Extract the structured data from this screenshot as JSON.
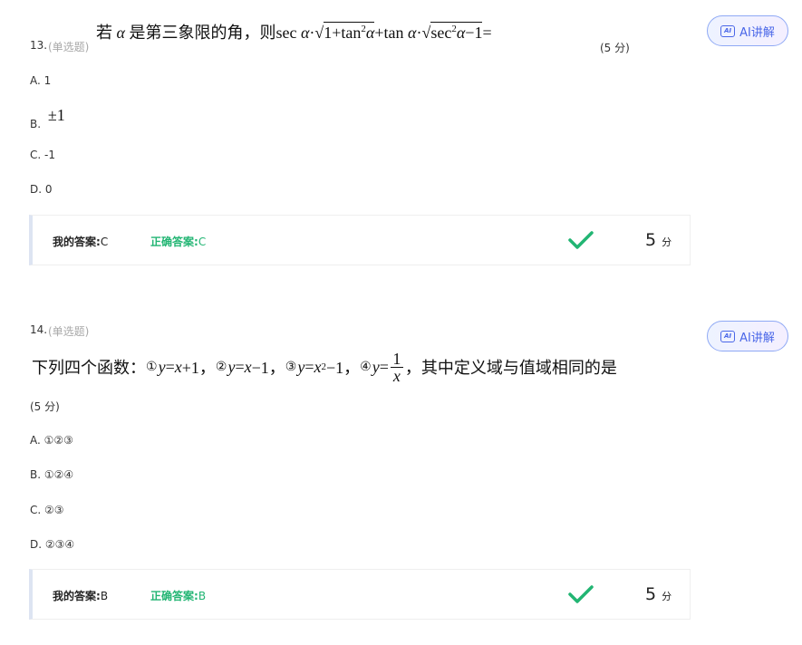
{
  "ai_button_label": "AI讲解",
  "questions": [
    {
      "number": "13.",
      "type": "(单选题)",
      "stem_prefix": "若",
      "stem_mid": "是第三象限的角，则",
      "score_label": "(5 分)",
      "options": [
        {
          "letter": "A.",
          "text": "1"
        },
        {
          "letter": "B.",
          "text": "±1"
        },
        {
          "letter": "C.",
          "text": "-1"
        },
        {
          "letter": "D.",
          "text": "0"
        }
      ],
      "my_answer_label": "我的答案:",
      "my_answer": "C",
      "correct_answer_label": "正确答案:",
      "correct_answer": "C",
      "points": "5",
      "points_unit": "分"
    },
    {
      "number": "14.",
      "type": "(单选题)",
      "stem_prefix": "下列四个函数：",
      "stem_suffix": "，其中定义域与值域相同的是",
      "score_label": "(5 分)",
      "options": [
        {
          "letter": "A.",
          "text": "①②③"
        },
        {
          "letter": "B.",
          "text": "①②④"
        },
        {
          "letter": "C.",
          "text": "②③"
        },
        {
          "letter": "D.",
          "text": "②③④"
        }
      ],
      "my_answer_label": "我的答案:",
      "my_answer": "B",
      "correct_answer_label": "正确答案:",
      "correct_answer": "B",
      "points": "5",
      "points_unit": "分"
    }
  ],
  "colors": {
    "correct_green": "#22b573",
    "ai_blue": "#4a67e8",
    "answer_box_accent": "#dde4f2"
  },
  "icons": [
    "ai-icon",
    "checkmark-icon"
  ]
}
